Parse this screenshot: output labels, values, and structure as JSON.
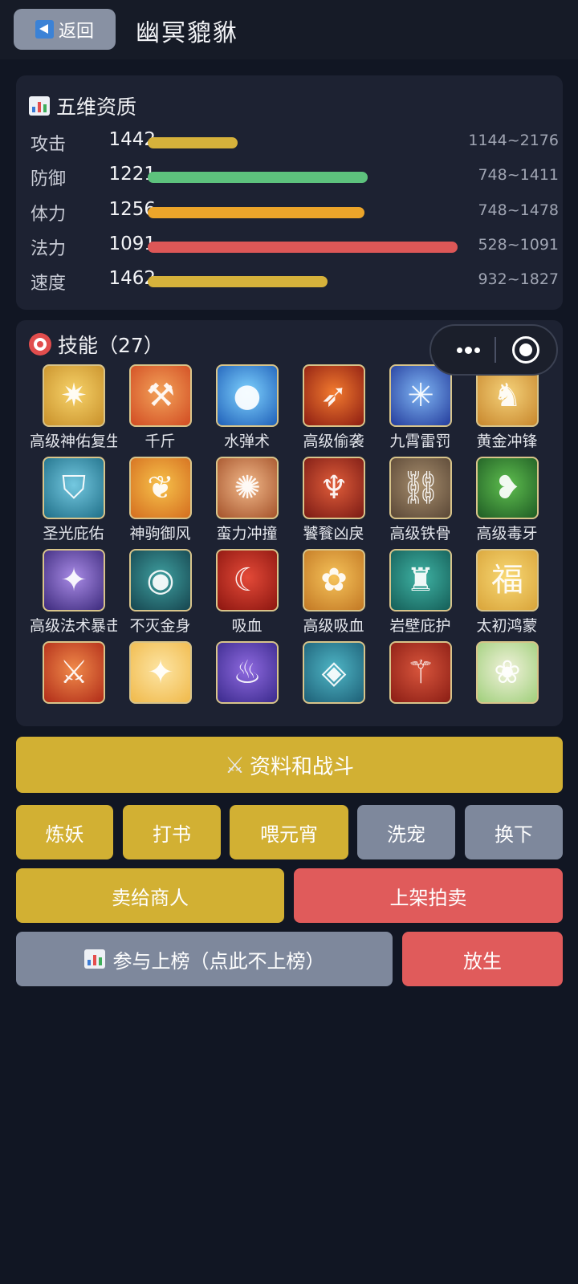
{
  "header": {
    "back_label": "返回",
    "title": "幽冥貔貅"
  },
  "stats": {
    "title": "五维资质",
    "rows": [
      {
        "label": "攻击",
        "value": "1442",
        "range": "1144~2176",
        "fill": 0.29,
        "color": "#d6b23b"
      },
      {
        "label": "防御",
        "value": "1221",
        "range": "748~1411",
        "fill": 0.71,
        "color": "#5dc27d"
      },
      {
        "label": "体力",
        "value": "1256",
        "range": "748~1478",
        "fill": 0.7,
        "color": "#eca52a"
      },
      {
        "label": "法力",
        "value": "1091",
        "range": "528~1091",
        "fill": 1.0,
        "color": "#dd5757"
      },
      {
        "label": "速度",
        "value": "1462",
        "range": "932~1827",
        "fill": 0.58,
        "color": "#d6b23b"
      }
    ]
  },
  "skills": {
    "title": "技能（27）",
    "items": [
      {
        "name": "高级神佑复生",
        "icon": "light-burst-icon",
        "colors": [
          "#f7d36a",
          "#c8902a"
        ]
      },
      {
        "name": "千斤",
        "icon": "hammer-icon",
        "colors": [
          "#f3a35a",
          "#d14b22"
        ]
      },
      {
        "name": "水弹术",
        "icon": "water-orb-icon",
        "colors": [
          "#7fd3ff",
          "#1f5fb8"
        ]
      },
      {
        "name": "高级偷袭",
        "icon": "fire-spear-icon",
        "colors": [
          "#f37b2f",
          "#8c1c12"
        ]
      },
      {
        "name": "九霄雷罚",
        "icon": "thunder-icon",
        "colors": [
          "#7fb5f3",
          "#243c9c"
        ]
      },
      {
        "name": "黄金冲锋",
        "icon": "golden-warrior-icon",
        "colors": [
          "#f5d27a",
          "#c7862c"
        ]
      },
      {
        "name": "圣光庇佑",
        "icon": "shield-icon",
        "colors": [
          "#74c8e0",
          "#1f6f88"
        ]
      },
      {
        "name": "神驹御风",
        "icon": "wing-icon",
        "colors": [
          "#f7c24b",
          "#d46d1f"
        ]
      },
      {
        "name": "蛮力冲撞",
        "icon": "explosion-icon",
        "colors": [
          "#f2b98a",
          "#a4522a"
        ]
      },
      {
        "name": "饕餮凶戾",
        "icon": "trident-icon",
        "colors": [
          "#e05d3a",
          "#7a1a14"
        ]
      },
      {
        "name": "高级铁骨",
        "icon": "wall-chain-icon",
        "colors": [
          "#a88f6e",
          "#5a4736"
        ]
      },
      {
        "name": "高级毒牙",
        "icon": "poison-fang-icon",
        "colors": [
          "#5fbf4f",
          "#1f5c24"
        ]
      },
      {
        "name": "高级法术暴击",
        "icon": "magic-crit-icon",
        "colors": [
          "#a98be6",
          "#3c2a7c"
        ]
      },
      {
        "name": "不灭金身",
        "icon": "golden-body-icon",
        "colors": [
          "#3fa0a0",
          "#16454f"
        ]
      },
      {
        "name": "吸血",
        "icon": "fangs-icon",
        "colors": [
          "#e44a38",
          "#8c1610"
        ]
      },
      {
        "name": "高级吸血",
        "icon": "gourd-icon",
        "colors": [
          "#f6c35a",
          "#c27824"
        ]
      },
      {
        "name": "岩壁庇护",
        "icon": "fortress-icon",
        "colors": [
          "#3fb3a4",
          "#155e58"
        ]
      },
      {
        "name": "太初鸿蒙",
        "icon": "fortune-icon",
        "colors": [
          "#f8d975",
          "#d9a43a"
        ]
      },
      {
        "name": "",
        "icon": "sword-icon",
        "colors": [
          "#f08a4a",
          "#b02b18"
        ]
      },
      {
        "name": "",
        "icon": "sparkle-icon",
        "colors": [
          "#fde5a4",
          "#f0b94a"
        ]
      },
      {
        "name": "",
        "icon": "flame-icon",
        "colors": [
          "#8f6ae0",
          "#3a2a8c"
        ]
      },
      {
        "name": "",
        "icon": "crystal-ring-icon",
        "colors": [
          "#4fb6c6",
          "#1d5f76"
        ]
      },
      {
        "name": "",
        "icon": "staff-icon",
        "colors": [
          "#d8553c",
          "#8a1d14"
        ]
      },
      {
        "name": "",
        "icon": "leaf-wreath-icon",
        "colors": [
          "#f2f2dc",
          "#9fcf7a"
        ]
      }
    ]
  },
  "actions": {
    "info_battle": "资料和战斗",
    "refine": "炼妖",
    "learn_book": "打书",
    "feed": "喂元宵",
    "wash": "洗宠",
    "swap": "换下",
    "sell_merchant": "卖给商人",
    "list_auction": "上架拍卖",
    "ranking": "参与上榜（点此不上榜）",
    "release": "放生"
  }
}
